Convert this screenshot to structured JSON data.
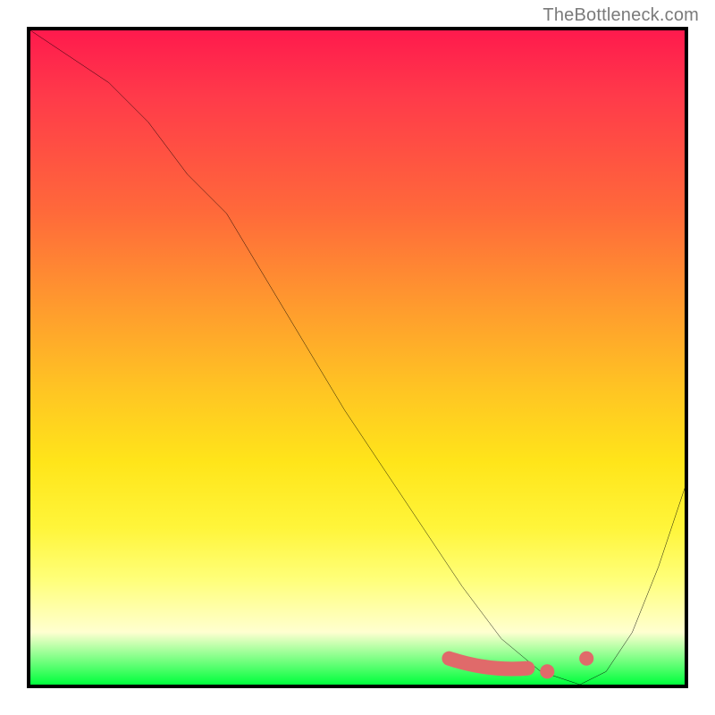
{
  "attribution": "TheBottleneck.com",
  "chart_data": {
    "type": "line",
    "title": "",
    "xlabel": "",
    "ylabel": "",
    "xlim": [
      0,
      100
    ],
    "ylim": [
      0,
      100
    ],
    "grid": false,
    "legend": false,
    "series": [
      {
        "name": "main-curve",
        "x": [
          0,
          6,
          12,
          18,
          24,
          30,
          36,
          42,
          48,
          54,
          60,
          66,
          72,
          78,
          84,
          88,
          92,
          96,
          100
        ],
        "values": [
          100,
          96,
          92,
          86,
          78,
          72,
          62,
          52,
          42,
          33,
          24,
          15,
          7,
          2,
          0,
          2,
          8,
          18,
          30
        ]
      }
    ],
    "annotations": [
      {
        "name": "trough-blob",
        "x_range": [
          64,
          76
        ],
        "y": 2.5
      },
      {
        "name": "trough-dot-1",
        "x": 79,
        "y": 2
      },
      {
        "name": "trough-dot-2",
        "x": 85,
        "y": 4
      }
    ],
    "background_gradient": {
      "stops": [
        {
          "pos": 0.0,
          "color": "#ff1a4d"
        },
        {
          "pos": 0.42,
          "color": "#ff9a2e"
        },
        {
          "pos": 0.66,
          "color": "#ffe51a"
        },
        {
          "pos": 0.92,
          "color": "#ffffd0"
        },
        {
          "pos": 1.0,
          "color": "#00ff3c"
        }
      ]
    }
  }
}
